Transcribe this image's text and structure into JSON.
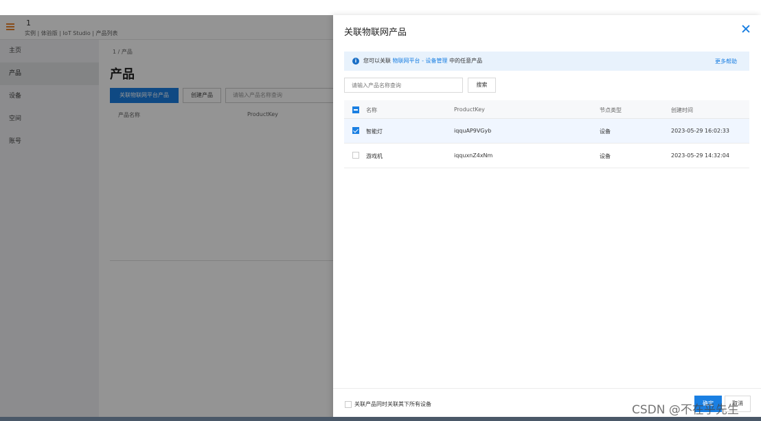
{
  "app": {
    "title": "1",
    "breadcrumb": "实例 | 体验版 | IoT Studio | 产品列表"
  },
  "sidebar": {
    "items": [
      {
        "label": "主页"
      },
      {
        "label": "产品"
      },
      {
        "label": "设备"
      },
      {
        "label": "空间"
      },
      {
        "label": "账号"
      }
    ]
  },
  "main": {
    "breadcrumb": "1 / 产品",
    "title": "产品",
    "link_button": "关联物联网平台产品",
    "create_button": "创建产品",
    "search_placeholder": "请输入产品名称查询",
    "columns": [
      "产品名称",
      "ProductKey"
    ]
  },
  "drawer": {
    "title": "关联物联网产品",
    "notice": {
      "prefix": "您可以关联",
      "link": "物联网平台 - 设备管理",
      "suffix": "中的任意产品",
      "help": "更多帮助"
    },
    "search": {
      "placeholder": "请输入产品名称查询",
      "button": "搜索"
    },
    "columns": {
      "name": "名称",
      "key": "ProductKey",
      "type": "节点类型",
      "time": "创建时间"
    },
    "rows": [
      {
        "name": "智能灯",
        "key": "iqquAP9VGyb",
        "type": "设备",
        "time": "2023-05-29 16:02:33",
        "checked": true
      },
      {
        "name": "游戏机",
        "key": "iqquxnZ4xNm",
        "type": "设备",
        "time": "2023-05-29 14:32:04",
        "checked": false
      }
    ],
    "footer": {
      "checkbox_label": "关联产品同时关联其下所有设备",
      "ok": "确定",
      "cancel": "取消"
    }
  },
  "watermark": "CSDN @不在乎先生",
  "colors": {
    "primary": "#1a7fe2",
    "menu_accent": "#e8842b",
    "notice_bg": "#e8f2fc"
  }
}
